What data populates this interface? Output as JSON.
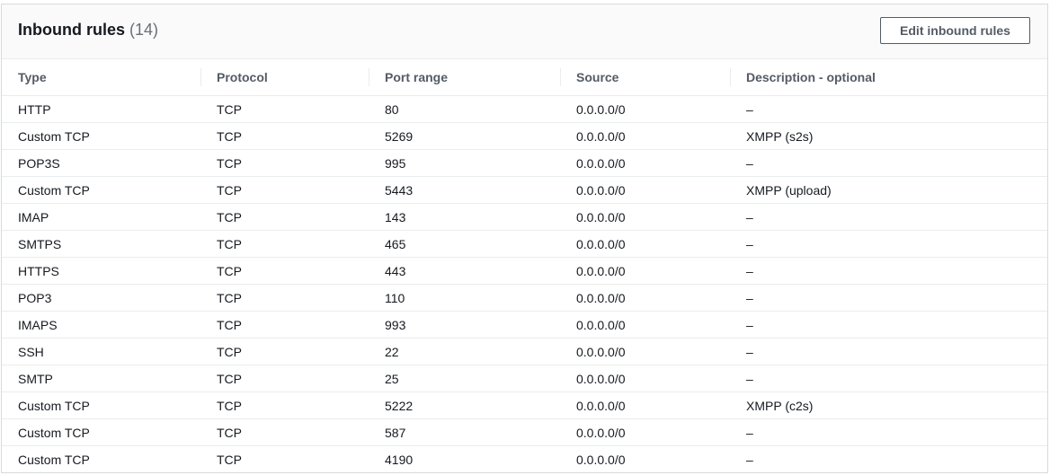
{
  "header": {
    "title": "Inbound rules",
    "count": "(14)",
    "edit_button_label": "Edit inbound rules"
  },
  "table": {
    "columns": [
      "Type",
      "Protocol",
      "Port range",
      "Source",
      "Description - optional"
    ],
    "rows": [
      [
        "HTTP",
        "TCP",
        "80",
        "0.0.0.0/0",
        "–"
      ],
      [
        "Custom TCP",
        "TCP",
        "5269",
        "0.0.0.0/0",
        "XMPP (s2s)"
      ],
      [
        "POP3S",
        "TCP",
        "995",
        "0.0.0.0/0",
        "–"
      ],
      [
        "Custom TCP",
        "TCP",
        "5443",
        "0.0.0.0/0",
        "XMPP (upload)"
      ],
      [
        "IMAP",
        "TCP",
        "143",
        "0.0.0.0/0",
        "–"
      ],
      [
        "SMTPS",
        "TCP",
        "465",
        "0.0.0.0/0",
        "–"
      ],
      [
        "HTTPS",
        "TCP",
        "443",
        "0.0.0.0/0",
        "–"
      ],
      [
        "POP3",
        "TCP",
        "110",
        "0.0.0.0/0",
        "–"
      ],
      [
        "IMAPS",
        "TCP",
        "993",
        "0.0.0.0/0",
        "–"
      ],
      [
        "SSH",
        "TCP",
        "22",
        "0.0.0.0/0",
        "–"
      ],
      [
        "SMTP",
        "TCP",
        "25",
        "0.0.0.0/0",
        "–"
      ],
      [
        "Custom TCP",
        "TCP",
        "5222",
        "0.0.0.0/0",
        "XMPP (c2s)"
      ],
      [
        "Custom TCP",
        "TCP",
        "587",
        "0.0.0.0/0",
        "–"
      ],
      [
        "Custom TCP",
        "TCP",
        "4190",
        "0.0.0.0/0",
        "–"
      ]
    ]
  },
  "colors": {
    "border": "#d5dbdb",
    "header_bg": "#fafafa",
    "text": "#16191f",
    "muted_text": "#545b64"
  }
}
